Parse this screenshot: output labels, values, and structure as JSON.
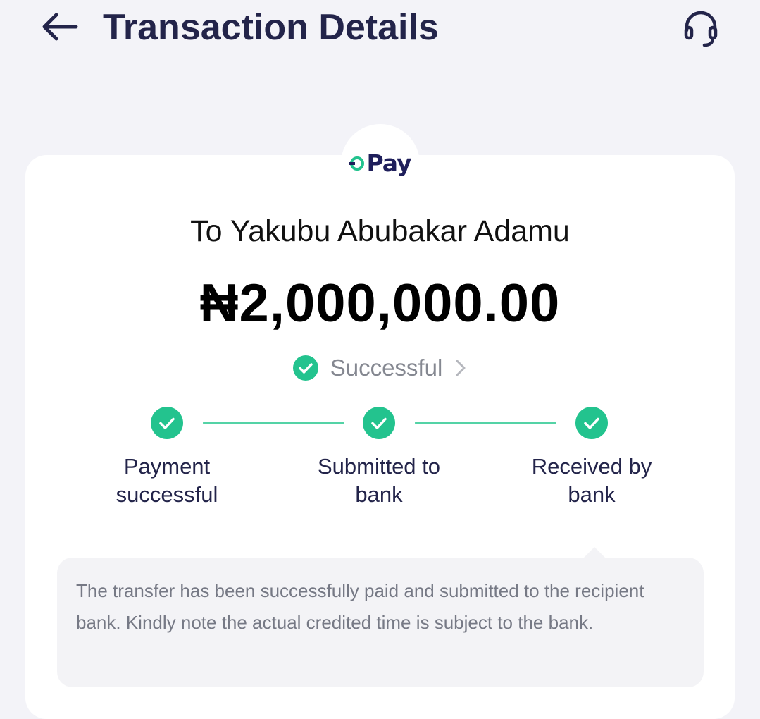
{
  "header": {
    "title": "Transaction Details",
    "back_icon": "arrow-left-icon",
    "support_icon": "headset-icon"
  },
  "brand": {
    "logo_text": "Pay",
    "logo_color": "#1f1f5b",
    "accent_color": "#23c38e"
  },
  "transaction": {
    "recipient": "To Yakubu Abubakar Adamu",
    "amount": "₦2,000,000.00",
    "status": "Successful"
  },
  "steps": [
    {
      "label_line1": "Payment",
      "label_line2": "successful",
      "done": true
    },
    {
      "label_line1": "Submitted to",
      "label_line2": "bank",
      "done": true
    },
    {
      "label_line1": "Received by",
      "label_line2": "bank",
      "done": true
    }
  ],
  "note": {
    "text": "The transfer has been successfully paid and submitted to the recipient bank. Kindly note the actual credited time is subject to the bank."
  },
  "colors": {
    "background": "#f3f3f8",
    "card": "#ffffff",
    "title": "#23244a",
    "success": "#23c38e",
    "step_line": "#54d3a6",
    "muted_text": "#858891"
  }
}
